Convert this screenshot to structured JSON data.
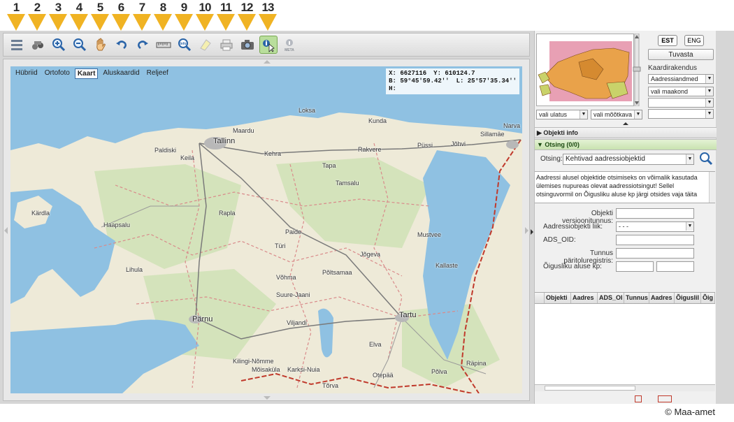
{
  "markers": [
    "1",
    "2",
    "3",
    "4",
    "5",
    "6",
    "7",
    "8",
    "9",
    "10",
    "11",
    "12",
    "13"
  ],
  "toolbar": {
    "buttons": [
      {
        "icon": "layers-icon"
      },
      {
        "icon": "binoculars-icon"
      },
      {
        "icon": "zoom-in-icon"
      },
      {
        "icon": "zoom-out-icon"
      },
      {
        "icon": "pan-hand-icon"
      },
      {
        "icon": "undo-icon"
      },
      {
        "icon": "redo-icon"
      },
      {
        "icon": "ruler-icon"
      },
      {
        "icon": "info-search-icon",
        "label": "Info"
      },
      {
        "icon": "eraser-icon"
      },
      {
        "icon": "print-icon"
      },
      {
        "icon": "camera-icon"
      },
      {
        "icon": "identify-cursor-icon",
        "active": true
      },
      {
        "icon": "meta-info-icon",
        "label": "META"
      }
    ]
  },
  "map": {
    "tabs": [
      "Hübriid",
      "Ortofoto",
      "Kaart",
      "Aluskaardid",
      "Reljeef"
    ],
    "selected_tab": "Kaart",
    "coords": {
      "x": "X: 6627116",
      "y": "Y: 610124.7",
      "b": "B: 59°45'59.42''",
      "l": "L: 25°57'35.34''",
      "h": "H:"
    },
    "places": [
      {
        "name": "Loksa"
      },
      {
        "name": "Kunda"
      },
      {
        "name": "Maardu"
      },
      {
        "name": "Tallinn",
        "big": true
      },
      {
        "name": "Paldiski"
      },
      {
        "name": "Keila"
      },
      {
        "name": "Kehra"
      },
      {
        "name": "Rakvere"
      },
      {
        "name": "Püssi"
      },
      {
        "name": "Jõhvi"
      },
      {
        "name": "Sillamäe"
      },
      {
        "name": "Narva"
      },
      {
        "name": "Tapa"
      },
      {
        "name": "Tamsalu"
      },
      {
        "name": "Kärdla"
      },
      {
        "name": "Haapsalu"
      },
      {
        "name": "Rapla"
      },
      {
        "name": "Paide"
      },
      {
        "name": "Mustvee"
      },
      {
        "name": "Türi"
      },
      {
        "name": "Jõgeva"
      },
      {
        "name": "Lihula"
      },
      {
        "name": "Põltsamaa"
      },
      {
        "name": "Võhma"
      },
      {
        "name": "Kallaste"
      },
      {
        "name": "Suure-Jaani"
      },
      {
        "name": "Pärnu",
        "big": true
      },
      {
        "name": "Viljandi"
      },
      {
        "name": "Tartu",
        "big": true
      },
      {
        "name": "Elva"
      },
      {
        "name": "Kilingi-Nõmme"
      },
      {
        "name": "Mõisaküla"
      },
      {
        "name": "Karksi-Nuia"
      },
      {
        "name": "Otepää"
      },
      {
        "name": "Põlva"
      },
      {
        "name": "Räpina"
      },
      {
        "name": "Tõrva"
      }
    ]
  },
  "panel": {
    "lang_est": "EST",
    "lang_eng": "ENG",
    "tuvasta": "Tuvasta",
    "kaardirakendus_label": "Kaardirakendus",
    "selects": {
      "app": "Aadressiandmed",
      "maakond": "vali maakond",
      "empty1": "",
      "empty2": "",
      "ulatus": "vali ulatus",
      "mootkava": "vali mõõtkava",
      "empty3": ""
    },
    "objekti_info": "Objekti info",
    "otsing_header": "Otsing (0/0)",
    "otsing_label": "Otsing:",
    "otsing_value": "Kehtivad aadressiobjektid",
    "info_text": "Aadressi alusel objektide otsimiseks on võimalik kasutada ülemises nupureas olevat aadressiotsingut! Sellel otsinguvormil on Õigusliku aluse kp järgi otsides vaja täita",
    "fields": [
      {
        "label": "Objekti versioonitunnus:",
        "value": ""
      },
      {
        "label": "Aadressiobjekti liik:",
        "value": "- - -",
        "select": true
      },
      {
        "label": "ADS_OID:",
        "value": ""
      },
      {
        "label": "Tunnus päritoluregistris:",
        "value": ""
      },
      {
        "label": "Õigusliku aluse kp:",
        "value": ""
      }
    ],
    "grid_columns": [
      "",
      "Objekti",
      "Aadres",
      "ADS_OI",
      "Tunnus",
      "Aadres",
      "Õiguslil",
      "Õig"
    ]
  },
  "copyright": "© Maa-amet",
  "colors": {
    "marker": "#f0b323",
    "sea": "#8fc1e2",
    "land": "#eeead8",
    "forest": "#c9ddb0",
    "active_tool": "#b9de9c",
    "border_red": "#c0392b"
  }
}
